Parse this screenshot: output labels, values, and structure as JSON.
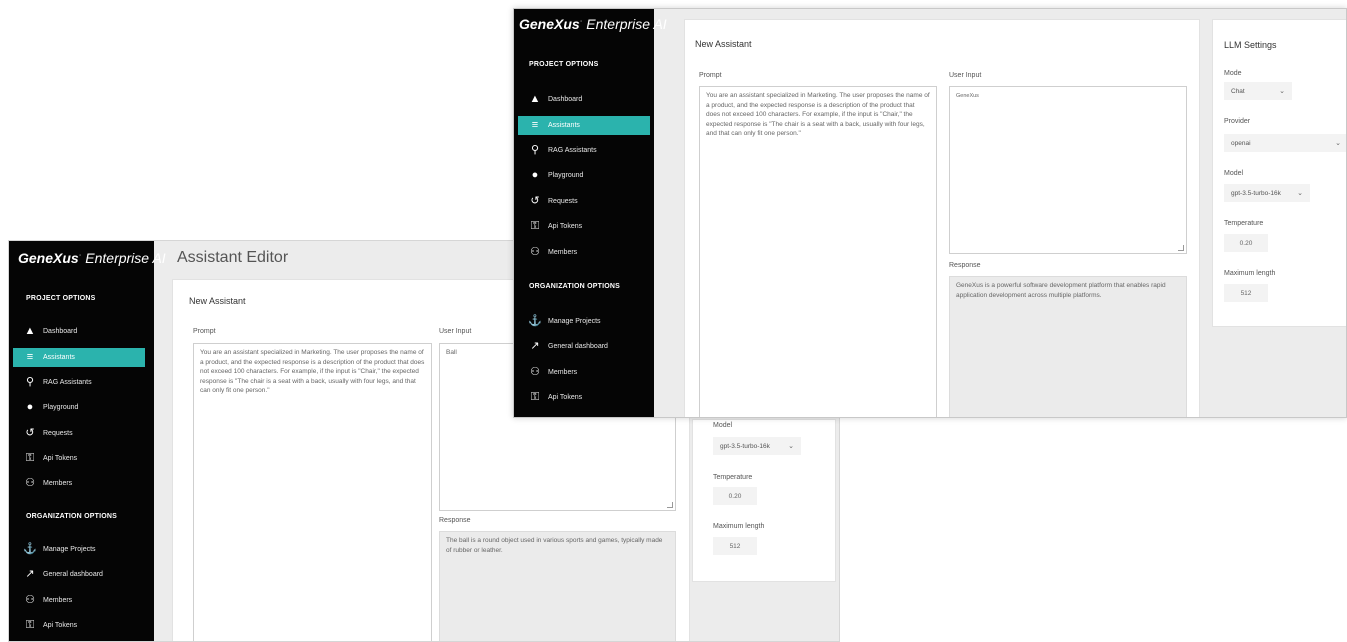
{
  "brand": {
    "bold": "GeneXus",
    "mark": "·",
    "rest": "Enterprise AI"
  },
  "sidebar": {
    "project_options_title": "PROJECT OPTIONS",
    "project_items": [
      {
        "label": "Dashboard",
        "icon": "home-icon"
      },
      {
        "label": "Assistants",
        "icon": "list-icon"
      },
      {
        "label": "RAG Assistants",
        "icon": "search-icon"
      },
      {
        "label": "Playground",
        "icon": "chat-icon"
      },
      {
        "label": "Requests",
        "icon": "history-icon"
      },
      {
        "label": "Api Tokens",
        "icon": "key-icon"
      },
      {
        "label": "Members",
        "icon": "users-icon"
      }
    ],
    "organization_options_title": "ORGANIZATION OPTIONS",
    "organization_items": [
      {
        "label": "Manage Projects",
        "icon": "projects-icon"
      },
      {
        "label": "General dashboard",
        "icon": "chart-icon"
      },
      {
        "label": "Members",
        "icon": "users-icon"
      },
      {
        "label": "Api Tokens",
        "icon": "key-icon"
      }
    ],
    "active_item": "Assistants"
  },
  "back_window": {
    "page_title": "Assistant Editor",
    "panel_title": "New Assistant",
    "prompt_label": "Prompt",
    "prompt_text": "You are an assistant specialized in Marketing. The user proposes the name of a product, and the expected response is a description of the product that does not exceed 100 characters. For example, if the input is \"Chair,\" the expected response is \"The chair is a seat with a back, usually with four legs, and that can only fit one person.\"",
    "user_input_label": "User Input",
    "user_input_value": "Ball",
    "response_label": "Response",
    "response_text": "The ball is a round object used in various sports and games, typically made of rubber or leather.",
    "model_label": "Model",
    "model_value": "gpt-3.5-turbo-16k",
    "temperature_label": "Temperature",
    "temperature_value": "0.20",
    "max_length_label": "Maximum length",
    "max_length_value": "512"
  },
  "front_window": {
    "panel_title": "New Assistant",
    "prompt_label": "Prompt",
    "prompt_text": "You are an assistant specialized in Marketing. The user proposes the name of a product, and the expected response is a description of the product that does not exceed 100 characters. For example, if the input is \"Chair,\" the expected response is \"The chair is a seat with a back, usually with four legs, and that can only fit one person.\"",
    "user_input_label": "User Input",
    "user_input_value": "GeneXus",
    "response_label": "Response",
    "response_text": "GeneXus is a powerful software development platform that enables rapid application development across multiple platforms.",
    "llm_title": "LLM Settings",
    "mode_label": "Mode",
    "mode_value": "Chat",
    "provider_label": "Provider",
    "provider_value": "openai",
    "model_label": "Model",
    "model_value": "gpt-3.5-turbo-16k",
    "temperature_label": "Temperature",
    "temperature_value": "0.20",
    "max_length_label": "Maximum length",
    "max_length_value": "512"
  }
}
